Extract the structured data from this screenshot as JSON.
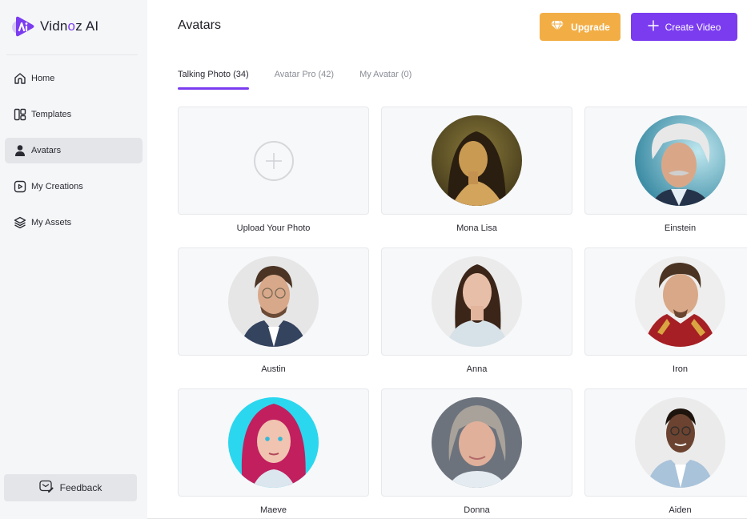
{
  "brand": {
    "name_prefix": "Vidn",
    "name_o": "o",
    "name_suffix": "z AI",
    "accent": "#7b3cf0"
  },
  "sidebar": {
    "items": [
      {
        "label": "Home",
        "icon": "home-icon"
      },
      {
        "label": "Templates",
        "icon": "templates-icon"
      },
      {
        "label": "Avatars",
        "icon": "user-icon",
        "active": true
      },
      {
        "label": "My Creations",
        "icon": "play-icon"
      },
      {
        "label": "My Assets",
        "icon": "layers-icon"
      }
    ],
    "feedback_label": "Feedback"
  },
  "header": {
    "title": "Avatars",
    "upgrade_label": "Upgrade",
    "create_label": "Create Video",
    "upgrade_color": "#f2ae45",
    "create_color": "#7b3cf0"
  },
  "tabs": [
    {
      "label": "Talking Photo (34)",
      "active": true
    },
    {
      "label": "Avatar Pro (42)"
    },
    {
      "label": "My Avatar (0)"
    }
  ],
  "cards": [
    {
      "label": "Upload Your Photo",
      "type": "upload"
    },
    {
      "label": "Mona Lisa"
    },
    {
      "label": "Einstein"
    },
    {
      "label": "Austin"
    },
    {
      "label": "Anna"
    },
    {
      "label": "Iron"
    },
    {
      "label": "Maeve"
    },
    {
      "label": "Donna"
    },
    {
      "label": "Aiden"
    }
  ]
}
